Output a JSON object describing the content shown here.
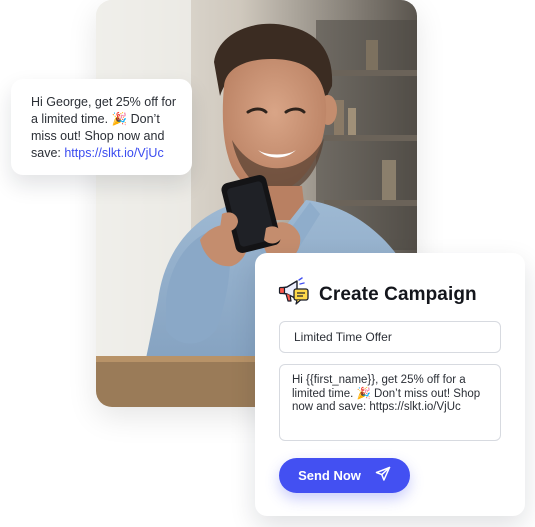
{
  "sms_preview": {
    "text": "Hi George, get 25% off for a limited time. 🎉 Don’t miss out! Shop now and save: ",
    "link": "https://slkt.io/VjUc"
  },
  "campaign": {
    "title": "Create Campaign",
    "subject_value": "Limited Time Offer",
    "message_value": "Hi {{first_name}}, get 25% off for a limited time. 🎉 Don’t miss out! Shop now and save: https://slkt.io/VjUc",
    "send_label": "Send Now"
  },
  "icons": {
    "campaign_icon": "megaphone-icon",
    "send_icon": "paper-plane-icon"
  },
  "colors": {
    "accent": "#4350f2",
    "link": "#3b4cf0"
  }
}
